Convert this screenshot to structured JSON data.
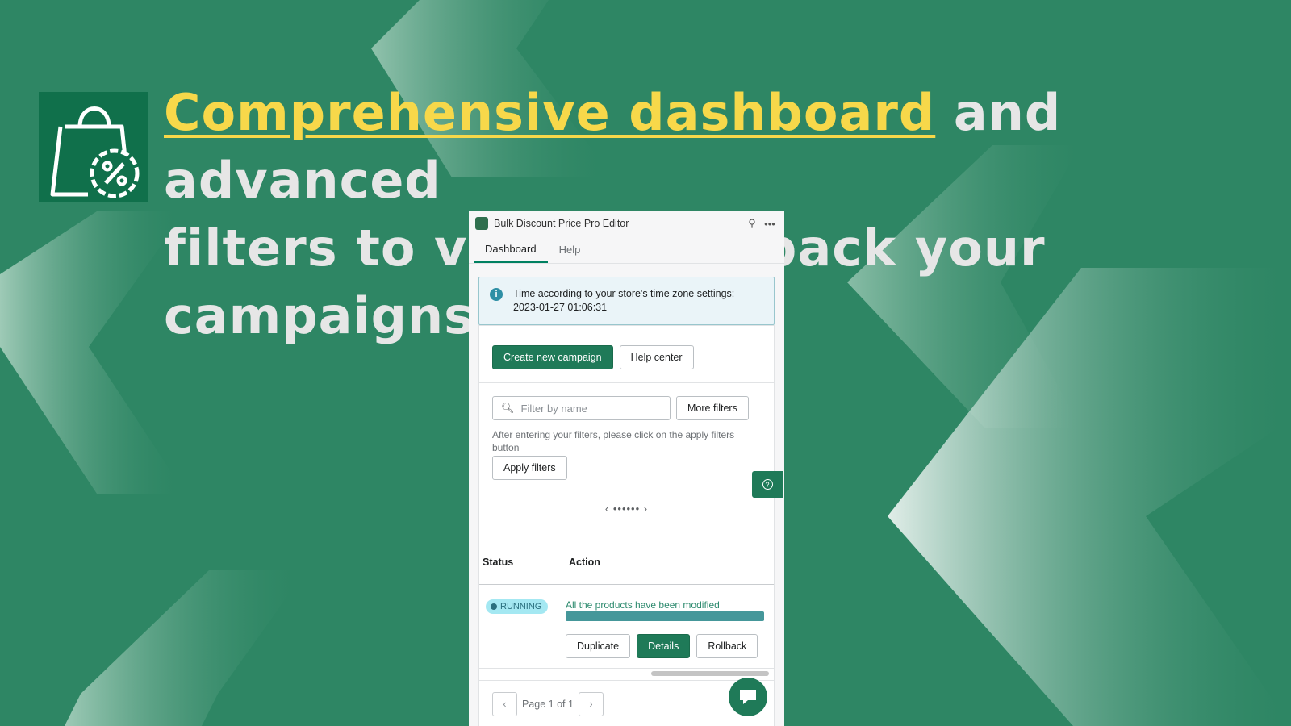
{
  "headline": {
    "highlight": "Comprehensive dashboard",
    "line1_rest": " and advanced",
    "line2": "filters  to view or rollback your campaigns"
  },
  "logo": {
    "icon": "shopping-bag-percent-icon"
  },
  "app": {
    "title": "Bulk Discount Price Pro Editor",
    "titlebar_icons": [
      "pin-icon",
      "more-horizontal-icon"
    ],
    "tabs": [
      {
        "label": "Dashboard",
        "active": true
      },
      {
        "label": "Help",
        "active": false
      }
    ],
    "banner": {
      "icon": "info-icon",
      "line1": "Time according to your store's time zone settings:",
      "line2": "2023-01-27 01:06:31"
    },
    "actions": {
      "create_label": "Create new campaign",
      "help_center_label": "Help center"
    },
    "filters": {
      "search_placeholder": "Filter by name",
      "search_value": "",
      "more_filters_label": "More filters",
      "hint": "After entering your filters, please click on the apply filters button",
      "apply_label": "Apply filters"
    },
    "carousel": {
      "prev": "‹",
      "next": "›",
      "dots": "••••••",
      "active_dot": 6,
      "total_dots": 6
    },
    "table": {
      "headers": {
        "status": "Status",
        "action": "Action"
      },
      "rows": [
        {
          "status": "RUNNING",
          "progress_label": "All the products have been modified",
          "progress_percent": 100,
          "buttons": {
            "duplicate": "Duplicate",
            "details": "Details",
            "rollback": "Rollback"
          }
        }
      ]
    },
    "pagination": {
      "text": "Page 1 of 1",
      "prev": "‹",
      "next": "›"
    }
  },
  "floating": {
    "help_icon": "question-circle-icon",
    "chat_icon": "chat-bubble-icon"
  },
  "colors": {
    "background": "#2e8664",
    "headline_highlight": "#f7d84a",
    "headline_text": "#e6e6e6",
    "primary_button": "#1f7a58",
    "badge_bg": "#a4e8f2",
    "progress_fill": "#45979a"
  }
}
